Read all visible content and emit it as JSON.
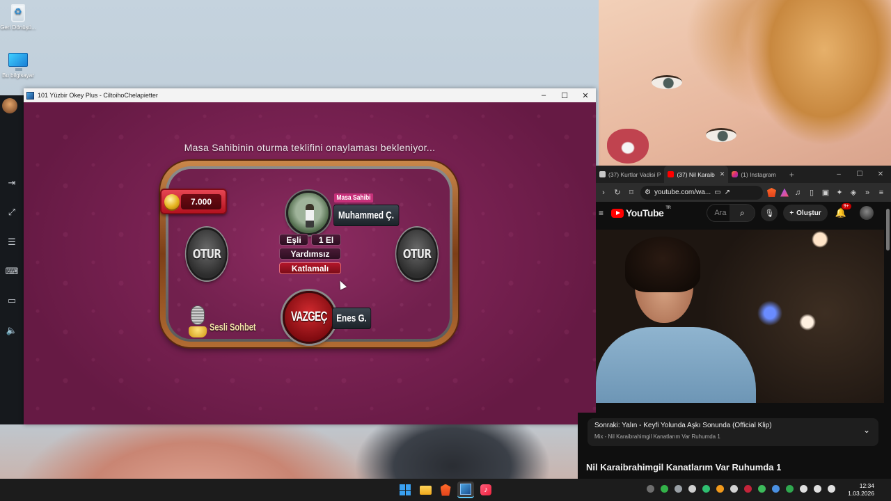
{
  "desktop": {
    "icons": [
      {
        "label": "Geri Dönüşü...",
        "icon": "recycle-bin-icon"
      },
      {
        "label": "Bu bilgisayar",
        "icon": "this-pc-icon"
      }
    ]
  },
  "game_window": {
    "title": "101 Yüzbir Okey Plus - CiltoihoChelapietter",
    "controls": {
      "minimize": "–",
      "maximize": "☐",
      "close": "✕"
    },
    "status_message": "Masa Sahibinin oturma teklifini onaylaması bekleniyor...",
    "coins": "7.000",
    "seat_left_label": "OTUR",
    "seat_right_label": "OTUR",
    "host_tag": "Masa Sahibi",
    "host_name": "Muhammed Ç.",
    "rules": {
      "mode": "Eşli",
      "rounds": "1 El",
      "assist": "Yardımsız",
      "scoring": "Katlamalı"
    },
    "exit_label": "VAZGEÇ",
    "guest_name": "Enes G.",
    "voice_chat_label": "Sesli Sohbet"
  },
  "browser": {
    "tabs": [
      {
        "label": "(37) Kurtlar Vadisi P",
        "icon": "tab-favicon",
        "active": false
      },
      {
        "label": "(37) Nil Karaib",
        "icon": "youtube-icon",
        "active": true
      },
      {
        "label": "(1) Instagram",
        "icon": "instagram-icon",
        "active": false
      }
    ],
    "url": "youtube.com/wa...",
    "youtube": {
      "logo_text": "YouTube",
      "region": "TR",
      "search_placeholder": "Ara",
      "create_label": "Oluştur",
      "notification_count": "9+",
      "up_next_title": "Sonraki: Yalın - Keyfi Yolunda Aşkı Sonunda (Official Klip)",
      "up_next_subtitle": "Mix - Nil Karaibrahimgil Kanatlarım Var Ruhumda 1",
      "video_title": "Nil Karaibrahimgil Kanatlarım Var Ruhumda 1"
    }
  },
  "taskbar": {
    "time": "12:34",
    "date": "1.03.2026"
  },
  "colors": {
    "game_bg": "#7a2253",
    "accent_red": "#b3121f",
    "youtube_red": "#ff0000",
    "taskbar": "#1c1c1c"
  }
}
